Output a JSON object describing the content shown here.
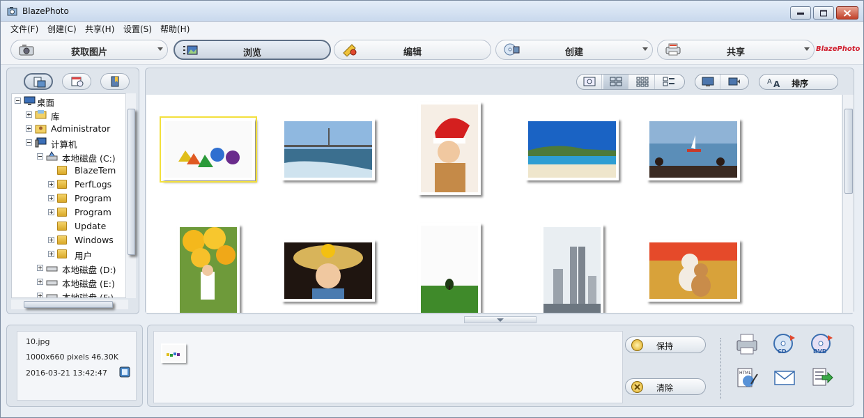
{
  "window": {
    "title": "BlazePhoto"
  },
  "menu": [
    {
      "label": "文件(F)"
    },
    {
      "label": "创建(C)"
    },
    {
      "label": "共享(H)"
    },
    {
      "label": "设置(S)"
    },
    {
      "label": "帮助(H)"
    }
  ],
  "toolbar": {
    "buttons": [
      {
        "label": "获取图片",
        "icon": "camera-icon",
        "dropdown": true
      },
      {
        "label": "浏览",
        "icon": "browse-icon",
        "active": true
      },
      {
        "label": "编辑",
        "icon": "edit-icon"
      },
      {
        "label": "创建",
        "icon": "cd-create-icon",
        "dropdown": true
      },
      {
        "label": "共享",
        "icon": "printer-share-icon",
        "dropdown": true
      }
    ],
    "brand": "BlazePhoto"
  },
  "tree": {
    "items": [
      {
        "label": "桌面"
      },
      {
        "label": "库"
      },
      {
        "label": "Administrator"
      },
      {
        "label": "计算机"
      },
      {
        "label": "本地磁盘 (C:)"
      },
      {
        "label": "BlazeTem"
      },
      {
        "label": "PerfLogs"
      },
      {
        "label": "Program"
      },
      {
        "label": "Program"
      },
      {
        "label": "Update"
      },
      {
        "label": "Windows"
      },
      {
        "label": "用户"
      },
      {
        "label": "本地磁盘 (D:)"
      },
      {
        "label": "本地磁盘 (E:)"
      },
      {
        "label": "本地磁盘 (F:)"
      }
    ]
  },
  "view": {
    "sort_label": "排序"
  },
  "info": {
    "filename": "10.jpg",
    "dimensions": "1000x660 pixels  46.30K",
    "datetime": "2016-03-21 13:42:47"
  },
  "tray": {
    "keep_label": "保持",
    "clear_label": "清除"
  }
}
